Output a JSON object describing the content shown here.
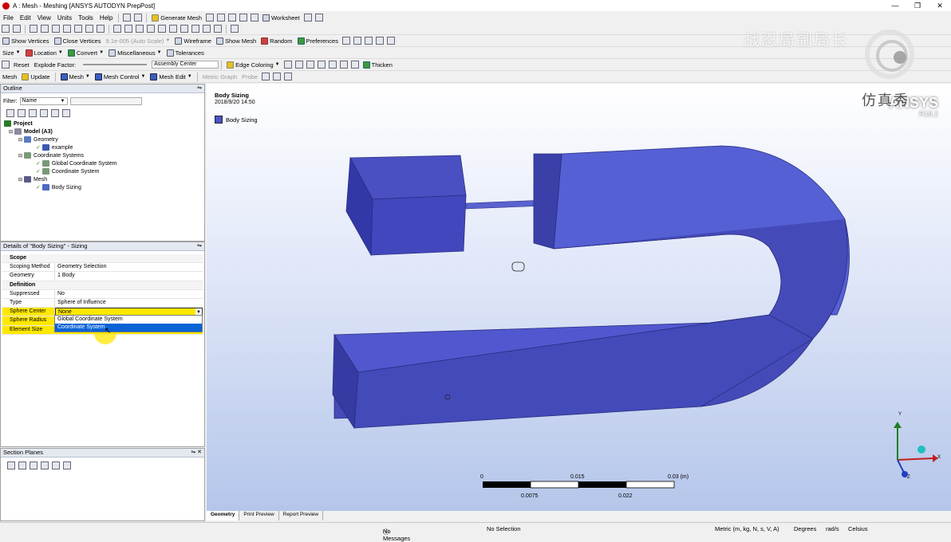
{
  "window": {
    "title": "A : Mesh - Meshing [ANSYS AUTODYN PrepPost]"
  },
  "menu": [
    "File",
    "Edit",
    "View",
    "Units",
    "Tools",
    "Help"
  ],
  "toolbar1": {
    "generate_mesh": "Generate Mesh",
    "worksheet": "Worksheet"
  },
  "toolbar2": {
    "show_vertices": "Show Vertices",
    "close_vertices": "Close Vertices",
    "scale": "9.1e-005 (Auto Scale)",
    "wireframe": "Wireframe",
    "show_mesh": "Show Mesh",
    "random": "Random",
    "preferences": "Preferences"
  },
  "toolbar3": {
    "size": "Size",
    "location": "Location",
    "convert": "Convert",
    "misc": "Miscellaneous",
    "tolerances": "Tolerances"
  },
  "toolbar4": {
    "reset": "Reset",
    "explode": "Explode Factor:",
    "assembly": "Assembly Center",
    "edge_coloring": "Edge Coloring",
    "thicken": "Thicken"
  },
  "toolbar5": {
    "mesh": "Mesh",
    "update": "Update",
    "mesh_menu": "Mesh",
    "mesh_control": "Mesh Control",
    "mesh_edit": "Mesh Edit",
    "metric_graph": "Metric Graph",
    "probe": "Probe"
  },
  "outline": {
    "title": "Outline",
    "filter_label": "Filter:",
    "filter_value": "Name",
    "tree": [
      "Project",
      "Model (A3)",
      "Geometry",
      "example",
      "Coordinate Systems",
      "Global Coordinate System",
      "Coordinate System",
      "Mesh",
      "Body Sizing"
    ]
  },
  "details": {
    "title": "Details of \"Body Sizing\" - Sizing",
    "rows": [
      {
        "k": "Scope",
        "v": ""
      },
      {
        "k": "Scoping Method",
        "v": "Geometry Selection"
      },
      {
        "k": "Geometry",
        "v": "1 Body"
      },
      {
        "k": "Definition",
        "v": ""
      },
      {
        "k": "Suppressed",
        "v": "No"
      },
      {
        "k": "Type",
        "v": "Sphere of Influence"
      },
      {
        "k": "Sphere Center",
        "v": "None"
      },
      {
        "k": "Sphere Radius",
        "v": ""
      },
      {
        "k": "Element Size",
        "v": ""
      }
    ],
    "dropdown": [
      "Global Coordinate System",
      "Coordinate System"
    ]
  },
  "section_planes": {
    "title": "Section Planes"
  },
  "viewport": {
    "label_title": "Body Sizing",
    "date": "2018/9/20 14:50",
    "legend": "Body Sizing",
    "logo": "ANSYS",
    "version": "R18.2",
    "scale": {
      "ticks_top": [
        "0",
        "0.015",
        "0.03 (m)"
      ],
      "ticks_bottom": [
        "0.0075",
        "0.022"
      ]
    },
    "axes": {
      "x": "X",
      "y": "Y",
      "z": "Z"
    }
  },
  "tabs": [
    "Geometry",
    "Print Preview",
    "Report Preview"
  ],
  "status": {
    "messages": "No Messages",
    "selection": "No Selection",
    "units": "Metric (m, kg, N, s, V, A)",
    "angle": "Degrees",
    "rot": "rad/s",
    "temp": "Celsius"
  },
  "watermarks": [
    "战忍局副局长",
    "仿真秀"
  ],
  "colors": {
    "body": "#4a52c8",
    "highlight": "#ffe800",
    "select": "#0a64d6"
  }
}
